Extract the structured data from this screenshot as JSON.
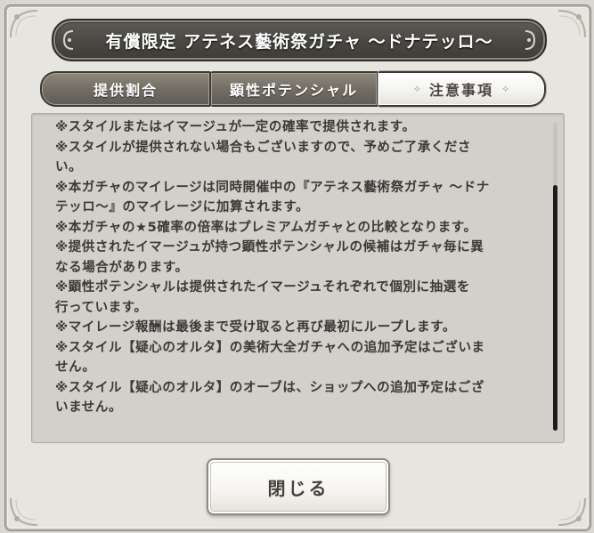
{
  "dialog": {
    "title": "有償限定 アテネス藝術祭ガチャ 〜ドナテッロ〜",
    "tabs": [
      {
        "label": "提供割合",
        "active": false
      },
      {
        "label": "顕性ポテンシャル",
        "active": false
      },
      {
        "label": "注意事項",
        "active": true
      }
    ],
    "notes": [
      "※スタイルまたはイマージュが一定の確率で提供されます。",
      "※スタイルが提供されない場合もございますので、予めご了承くださ",
      "い。",
      "※本ガチャのマイレージは同時開催中の『アテネス藝術祭ガチャ 〜ドナ",
      "テッロ〜』のマイレージに加算されます。",
      "※本ガチャの★5確率の倍率はプレミアムガチャとの比較となります。",
      "※提供されたイマージュが持つ顕性ポテンシャルの候補はガチャ毎に異",
      "なる場合があります。",
      "※顕性ポテンシャルは提供されたイマージュそれぞれで個別に抽選を",
      "行っています。",
      "※マイレージ報酬は最後まで受け取ると再び最初にループします。",
      "※スタイル【疑心のオルタ】の美術大全ガチャへの追加予定はございま",
      "せん。",
      "※スタイル【疑心のオルタ】のオーブは、ショップへの追加予定はござ",
      "いません。"
    ],
    "close_label": "閉じる",
    "tab_deco_left": "⟡",
    "tab_deco_right": "⟡"
  }
}
